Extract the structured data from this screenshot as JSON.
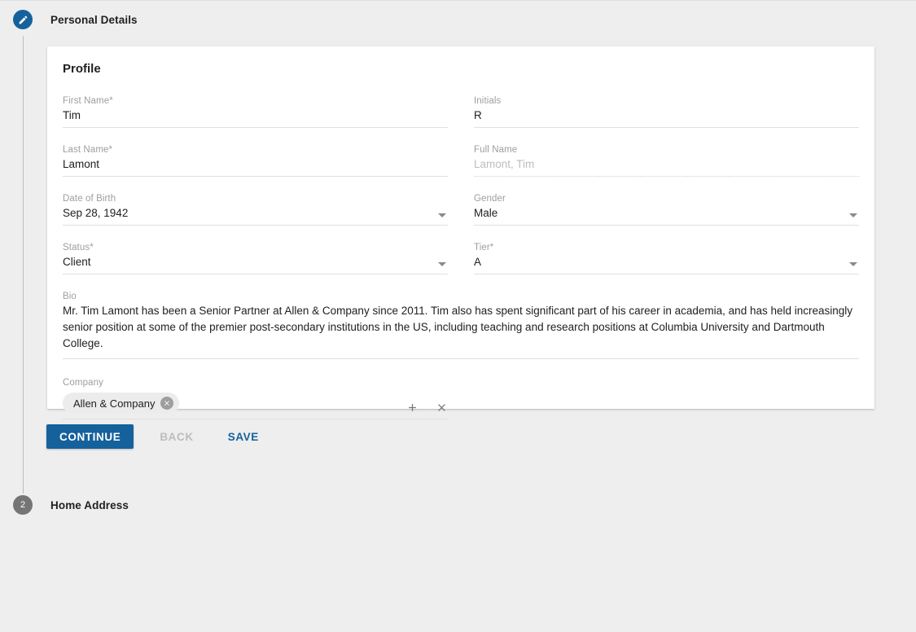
{
  "theme": {
    "accent": "#15619c",
    "page_bg": "#eeeeee",
    "card_bg": "#ffffff",
    "label_color": "#9e9e9e",
    "disabled_color": "#bdbdbd",
    "step_idle_bg": "#757575"
  },
  "stepper": {
    "step1": {
      "label": "Personal Details",
      "icon": "pencil-icon",
      "state": "completed"
    },
    "step2": {
      "label": "Home Address",
      "number": "2",
      "state": "inactive"
    }
  },
  "card": {
    "title": "Profile",
    "fields": {
      "first_name": {
        "label": "First Name*",
        "value": "Tim"
      },
      "initials": {
        "label": "Initials",
        "value": "R"
      },
      "last_name": {
        "label": "Last Name*",
        "value": "Lamont"
      },
      "full_name": {
        "label": "Full Name",
        "value": "Lamont, Tim",
        "disabled": true
      },
      "date_of_birth": {
        "label": "Date of Birth",
        "value": "Sep 28, 1942"
      },
      "gender": {
        "label": "Gender",
        "value": "Male"
      },
      "status": {
        "label": "Status*",
        "value": "Client"
      },
      "tier": {
        "label": "Tier*",
        "value": "A"
      },
      "bio": {
        "label": "Bio",
        "value": "Mr. Tim Lamont has been a Senior Partner at Allen & Company since 2011. Tim also has spent significant part of his career in academia, and has held increasingly senior position at some of the premier post-secondary institutions in the US, including teaching and research positions at Columbia University and Dartmouth College."
      },
      "company": {
        "label": "Company",
        "chips": [
          {
            "label": "Allen & Company"
          }
        ],
        "add_icon": "plus-icon",
        "clear_icon": "close-icon"
      }
    }
  },
  "actions": {
    "continue_label": "CONTINUE",
    "back_label": "BACK",
    "save_label": "SAVE"
  }
}
